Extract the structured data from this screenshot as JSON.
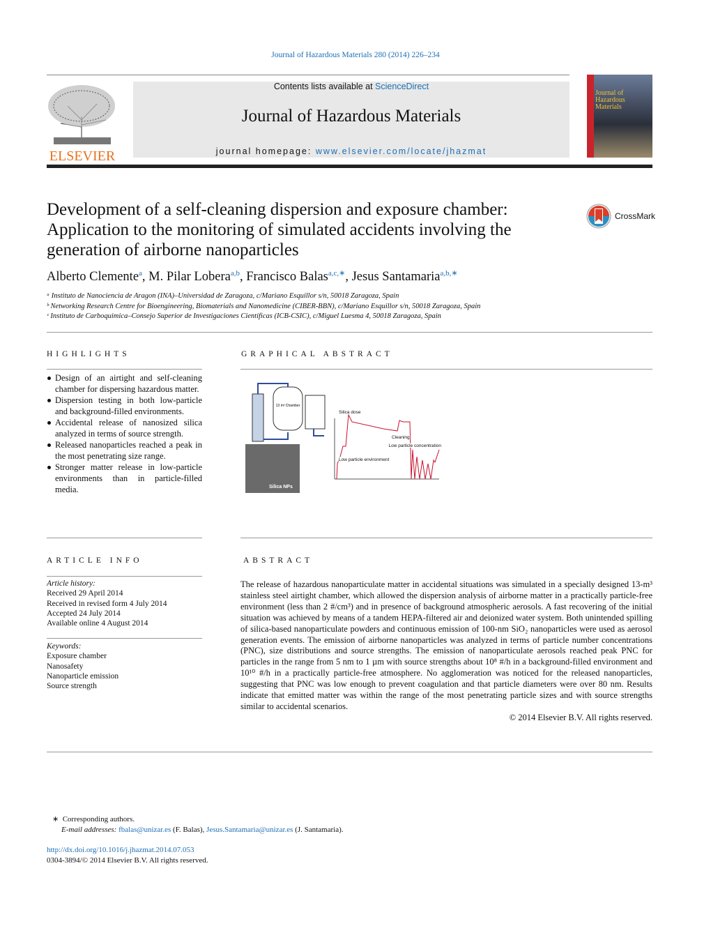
{
  "journal_ref": "Journal of Hazardous Materials 280 (2014) 226–234",
  "header": {
    "contents_prefix": "Contents lists available at ",
    "contents_link": "ScienceDirect",
    "journal_title": "Journal of Hazardous Materials",
    "homepage_prefix": "journal homepage: ",
    "homepage_link": "www.elsevier.com/locate/jhazmat",
    "publisher_logo": "ELSEVIER",
    "cover_text": "Journal of Hazardous Materials"
  },
  "crossmark": "CrossMark",
  "title": "Development of a self-cleaning dispersion and exposure chamber: Application to the monitoring of simulated accidents involving the generation of airborne nanoparticles",
  "authors": [
    {
      "name": "Alberto Clemente",
      "sup": "a"
    },
    {
      "name": "M. Pilar Lobera",
      "sup": "a,b"
    },
    {
      "name": "Francisco Balas",
      "sup": "a,c,∗"
    },
    {
      "name": "Jesus Santamaria",
      "sup": "a,b,∗"
    }
  ],
  "affiliations": [
    "ᵃ Instituto de Nanociencia de Aragon (INA)–Universidad de Zaragoza, c/Mariano Esquillor s/n, 50018 Zaragoza, Spain",
    "ᵇ Networking Research Centre for Bioengineering, Biomaterials and Nanomedicine (CIBER-BBN), c/Mariano Esquillor s/n, 50018 Zaragoza, Spain",
    "ᶜ Instituto de Carboquimica–Consejo Superior de Investigaciones Cientificas (ICB-CSIC), c/Miguel Luesma 4, 50018 Zaragoza, Spain"
  ],
  "highlights": {
    "heading": "HIGHLIGHTS",
    "items": [
      "Design of an airtight and self-cleaning chamber for dispersing hazardous matter.",
      "Dispersion testing in both low-particle and background-filled environments.",
      "Accidental release of nanosized silica analyzed in terms of source strength.",
      "Released nanoparticles reached a peak in the most penetrating size range.",
      "Stronger matter release in low-particle environments than in particle-filled media."
    ]
  },
  "graphical_abstract": {
    "heading": "GRAPHICAL ABSTRACT",
    "chamber_label": "13 m³ Chamber",
    "sem_label": "Silica NPs",
    "annotations": [
      "Silica dose",
      "Cleaning",
      "Low particle environment",
      "Low particle concentration"
    ]
  },
  "article_info": {
    "heading": "ARTICLE INFO",
    "history_label": "Article history:",
    "history": [
      "Received 29 April 2014",
      "Received in revised form 4 July 2014",
      "Accepted 24 July 2014",
      "Available online 4 August 2014"
    ],
    "keywords_label": "Keywords:",
    "keywords": [
      "Exposure chamber",
      "Nanosafety",
      "Nanoparticle emission",
      "Source strength"
    ]
  },
  "abstract": {
    "heading": "ABSTRACT",
    "text": "The release of hazardous nanoparticulate matter in accidental situations was simulated in a specially designed 13-m³ stainless steel airtight chamber, which allowed the dispersion analysis of airborne matter in a practically particle-free environment (less than 2 #/cm³) and in presence of background atmospheric aerosols. A fast recovering of the initial situation was achieved by means of a tandem HEPA-filtered air and deionized water system. Both unintended spilling of silica-based nanoparticulate powders and continuous emission of 100-nm SiO₂ nanoparticles were used as aerosol generation events. The emission of airborne nanoparticles was analyzed in terms of particle number concentrations (PNC), size distributions and source strengths. The emission of nanoparticulate aerosols reached peak PNC for particles in the range from 5 nm to 1 µm with source strengths about 10⁸ #/h in a background-filled environment and 10¹⁰ #/h in a practically particle-free atmosphere. No agglomeration was noticed for the released nanoparticles, suggesting that PNC was low enough to prevent coagulation and that particle diameters were over 80 nm. Results indicate that emitted matter was within the range of the most penetrating particle sizes and with source strengths similar to accidental scenarios.",
    "copyright": "© 2014 Elsevier B.V. All rights reserved."
  },
  "footnote": {
    "star": "∗",
    "corresponding": "Corresponding authors.",
    "email_label": "E-mail addresses: ",
    "email1": "fbalas@unizar.es",
    "name1": " (F. Balas), ",
    "email2": "Jesus.Santamaria@unizar.es",
    "name2": " (J. Santamaria)."
  },
  "doi": "http://dx.doi.org/10.1016/j.jhazmat.2014.07.053",
  "issn": "0304-3894/© 2014 Elsevier B.V. All rights reserved.",
  "colors": {
    "link": "#1d6fb5",
    "elsevier": "#e9711c",
    "plot": "#c8102e"
  }
}
